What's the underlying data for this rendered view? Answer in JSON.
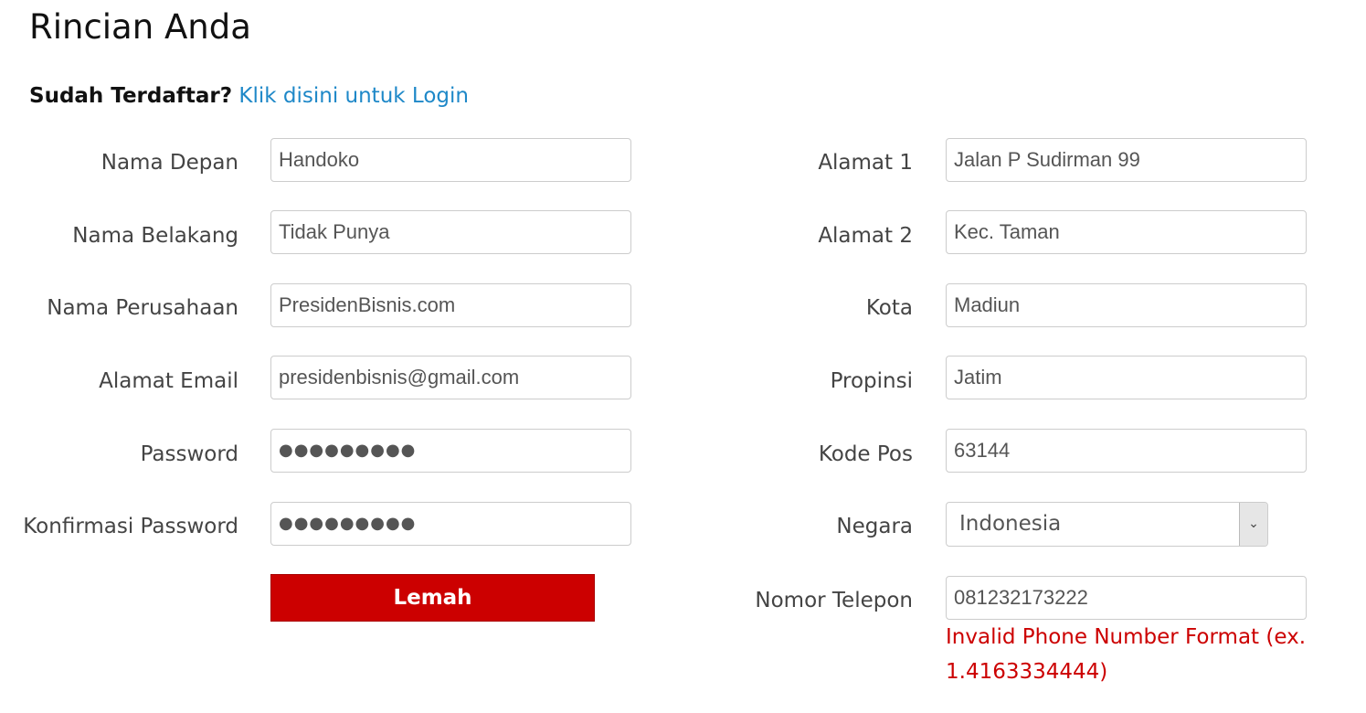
{
  "page_title": "Rincian Anda",
  "login_prompt": {
    "question": "Sudah Terdaftar?",
    "link": "Klik disini untuk Login"
  },
  "left_fields": [
    {
      "label": "Nama Depan",
      "value": "Handoko"
    },
    {
      "label": "Nama Belakang",
      "value": "Tidak Punya"
    },
    {
      "label": "Nama Perusahaan",
      "value": "PresidenBisnis.com"
    },
    {
      "label": "Alamat Email",
      "value": "presidenbisnis@gmail.com"
    },
    {
      "label": "Password",
      "value": "●●●●●●●●●"
    },
    {
      "label": "Konfirmasi Password",
      "value": "●●●●●●●●●"
    }
  ],
  "password_strength": {
    "label": "Lemah",
    "color": "#cc0000"
  },
  "right_fields": [
    {
      "label": "Alamat 1",
      "value": "Jalan P Sudirman 99"
    },
    {
      "label": "Alamat 2",
      "value": "Kec. Taman"
    },
    {
      "label": "Kota",
      "value": "Madiun"
    },
    {
      "label": "Propinsi",
      "value": "Jatim"
    },
    {
      "label": "Kode Pos",
      "value": "63144"
    }
  ],
  "country": {
    "label": "Negara",
    "selected": "Indonesia",
    "arrow_icon": "chevron-down-icon"
  },
  "phone": {
    "label": "Nomor Telepon",
    "value": "081232173222",
    "error": "Invalid Phone Number Format (ex. 1.4163334444)"
  },
  "colors": {
    "link": "#1e88c8",
    "error": "#cc0000"
  }
}
